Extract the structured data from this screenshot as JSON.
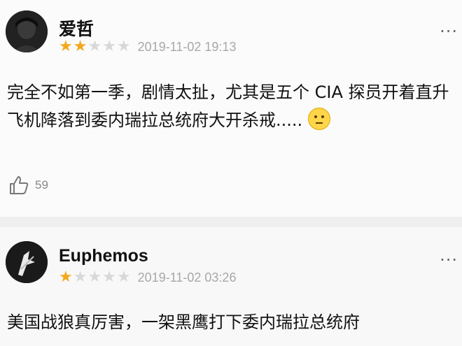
{
  "reviews": [
    {
      "username": "爱哲",
      "rating": 2,
      "max_rating": 5,
      "date": "2019-11-02 19:13",
      "text": "完全不如第一季，剧情太扯，尤其是五个 CIA 探员开着直升飞机降落到委内瑞拉总统府大开杀戒.....",
      "emoji": "thinking-face",
      "likes": "59",
      "more_label": "···"
    },
    {
      "username": "Euphemos",
      "rating": 1,
      "max_rating": 5,
      "date": "2019-11-02 03:26",
      "text": "美国战狼真厉害，一架黑鹰打下委内瑞拉总统府",
      "more_label": "···"
    }
  ],
  "colors": {
    "star_on": "#f2a81b",
    "star_off": "#d8d8d8",
    "date": "#a8a8a8",
    "divider": "#efefef"
  }
}
